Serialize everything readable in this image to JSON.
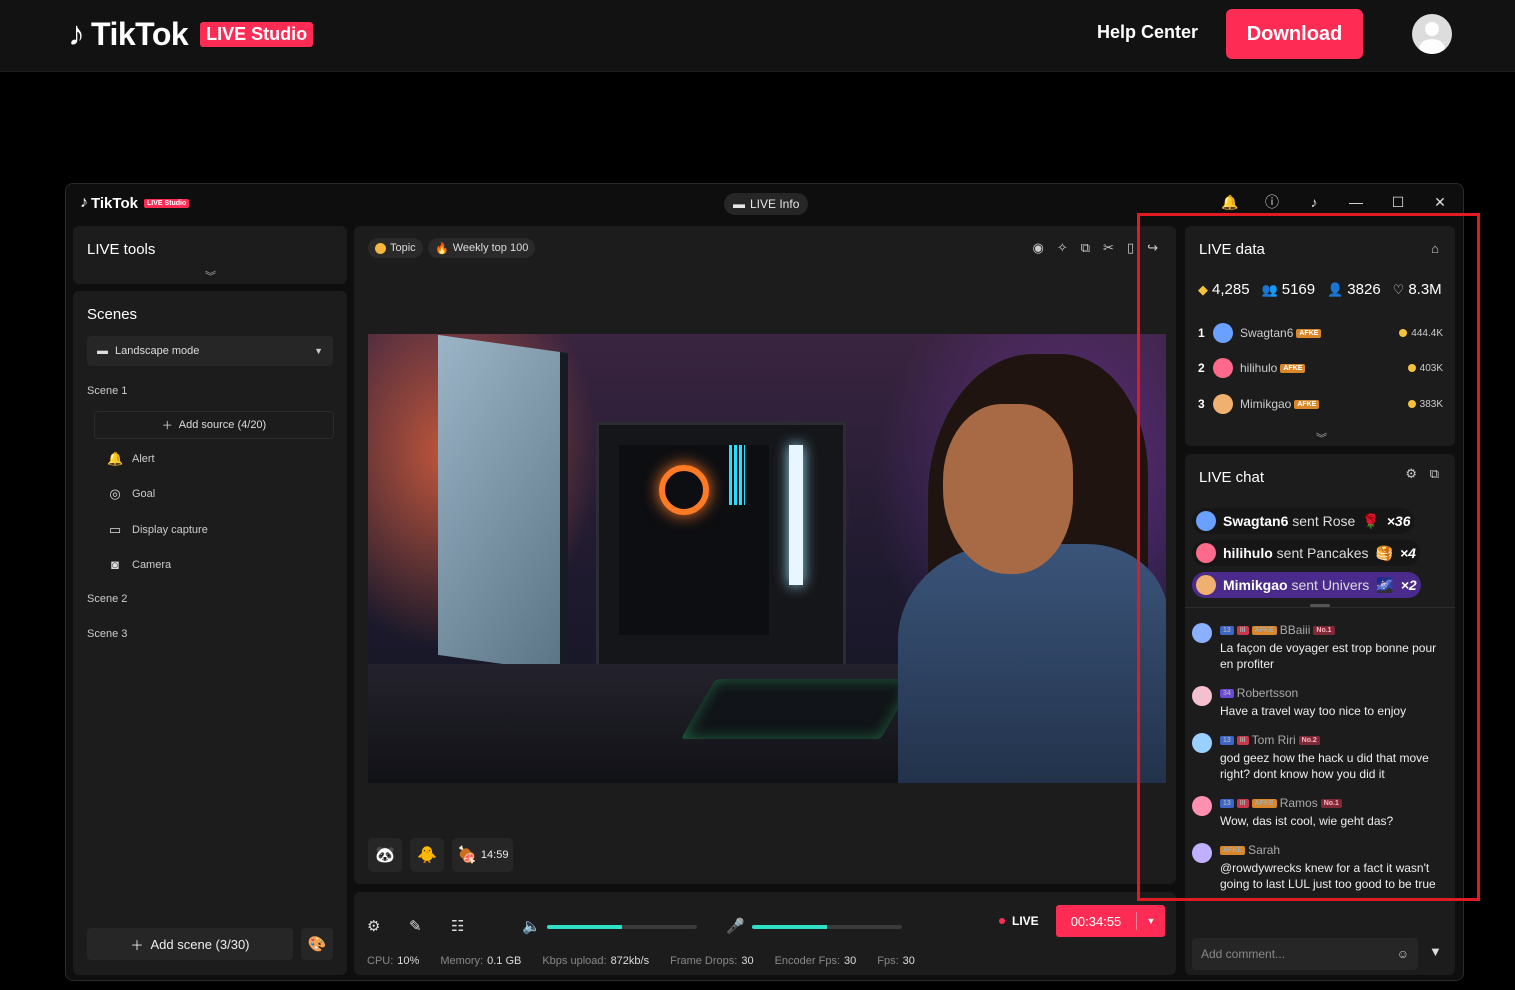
{
  "site": {
    "logo_word": "TikTok",
    "logo_badge": "LIVE Studio",
    "help": "Help Center",
    "download": "Download"
  },
  "window": {
    "title_word": "TikTok",
    "title_badge": "LIVE Studio",
    "live_info": "LIVE Info"
  },
  "left": {
    "live_tools": "LIVE tools",
    "scenes_title": "Scenes",
    "mode": "Landscape mode",
    "scene1": "Scene 1",
    "add_source": "Add source (4/20)",
    "sources": [
      "Alert",
      "Goal",
      "Display capture",
      "Camera"
    ],
    "scene2": "Scene 2",
    "scene3": "Scene 3",
    "add_scene": "Add scene (3/30)"
  },
  "preview": {
    "tag_topic": "Topic",
    "tag_weekly": "Weekly top 100",
    "timer": "14:59"
  },
  "controls": {
    "desktop_volume": 0.5,
    "mic_volume": 0.5,
    "live_label": "LIVE",
    "elapsed": "00:34:55",
    "stats": [
      {
        "label": "CPU:",
        "value": "10%"
      },
      {
        "label": "Memory:",
        "value": "0.1 GB"
      },
      {
        "label": "Kbps upload:",
        "value": "872kb/s"
      },
      {
        "label": "Frame Drops:",
        "value": "30"
      },
      {
        "label": "Encoder Fps:",
        "value": "30"
      },
      {
        "label": "Fps:",
        "value": "30"
      }
    ]
  },
  "live_data": {
    "title": "LIVE data",
    "coins": "4,285",
    "viewers": "5169",
    "followers": "3826",
    "likes": "8.3M",
    "ranking": [
      {
        "rank": "1",
        "name": "Swagtan6",
        "badge": "AFKE",
        "score": "444.4K",
        "color": "#6aa0ff"
      },
      {
        "rank": "2",
        "name": "hilihulo",
        "badge": "AFKE",
        "score": "403K",
        "color": "#ff6a8a"
      },
      {
        "rank": "3",
        "name": "Mimikgao",
        "badge": "AFKE",
        "score": "383K",
        "color": "#f0b070"
      }
    ]
  },
  "live_chat": {
    "title": "LIVE chat",
    "gifts": [
      {
        "user": "Swagtan6",
        "text": "sent Rose",
        "icon": "🌹",
        "count": "×36",
        "bg": "#161616"
      },
      {
        "user": "hilihulo",
        "text": "sent Pancakes",
        "icon": "🥞",
        "count": "×4",
        "bg": "#161616"
      },
      {
        "user": "Mimikgao",
        "text": "sent Univers",
        "icon": "🌌",
        "count": "×2",
        "bg": "#4a2a8a"
      }
    ],
    "messages": [
      {
        "name": "BBaiii",
        "badges": [
          "13",
          "III",
          "AFKE",
          "No.1"
        ],
        "text": "La façon de voyager est trop bonne pour en profiter"
      },
      {
        "name": "Robertsson",
        "badges": [
          "34"
        ],
        "text": "Have a travel way too nice to enjoy"
      },
      {
        "name": "Tom Riri",
        "badges": [
          "13",
          "III",
          "No.2"
        ],
        "text": "god geez how the hack u did that move right? dont know how you did it"
      },
      {
        "name": "Ramos",
        "badges": [
          "13",
          "III",
          "AFKE",
          "No.1"
        ],
        "text": "Wow, das ist cool, wie geht das?"
      },
      {
        "name": "Sarah",
        "badges": [
          "AFKE"
        ],
        "text": "@rowdywrecks knew for a fact it wasn't going to last LUL just too good to be true"
      }
    ],
    "comment_placeholder": "Add comment..."
  }
}
